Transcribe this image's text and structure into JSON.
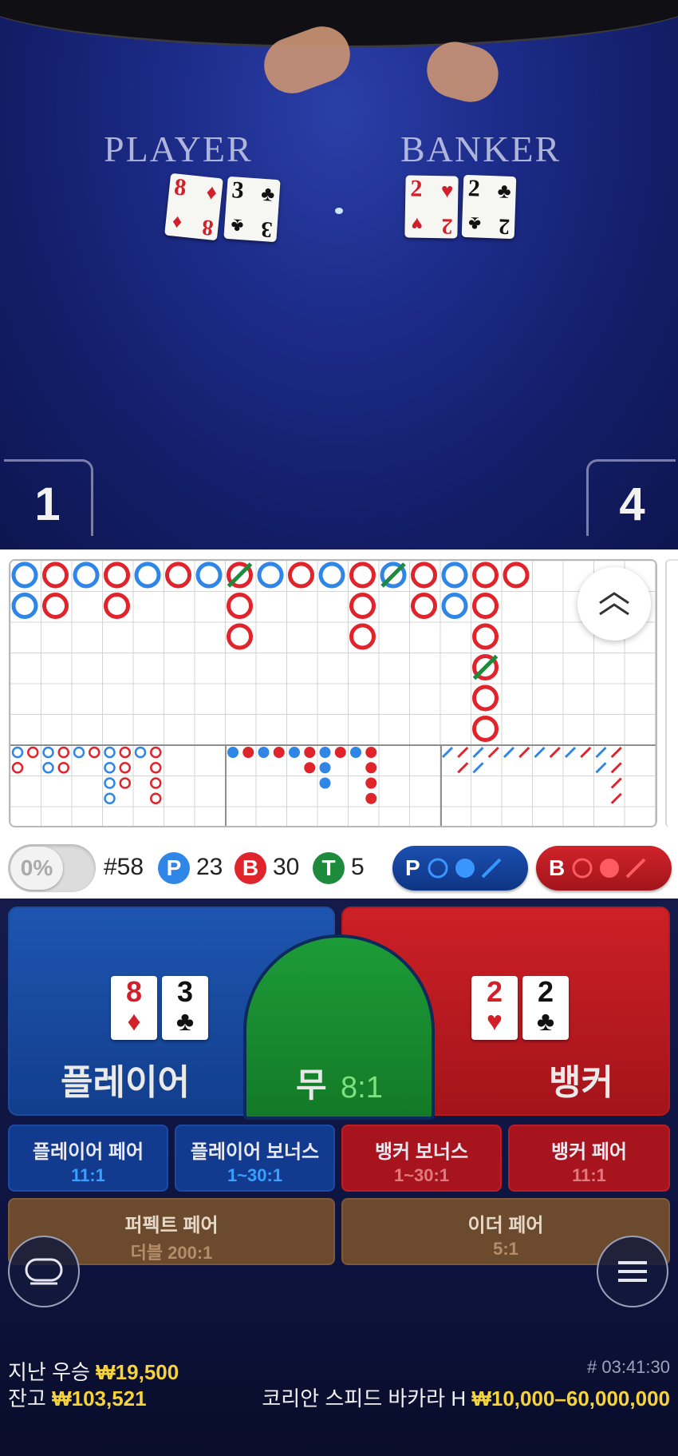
{
  "video": {
    "player_label": "PLAYER",
    "banker_label": "BANKER",
    "player_cards": [
      {
        "rank": "8",
        "suit": "♦",
        "color": "red"
      },
      {
        "rank": "3",
        "suit": "♣",
        "color": "black"
      }
    ],
    "banker_cards": [
      {
        "rank": "2",
        "suit": "♥",
        "color": "red"
      },
      {
        "rank": "2",
        "suit": "♣",
        "color": "black"
      }
    ],
    "player_score": "1",
    "banker_score": "4"
  },
  "stats": {
    "percent_toggle": "0%",
    "shoe_number": "#58",
    "player_letter": "P",
    "player_count": "23",
    "banker_letter": "B",
    "banker_count": "30",
    "tie_letter": "T",
    "tie_count": "5",
    "predict_player_label": "P",
    "predict_banker_label": "B"
  },
  "bets": {
    "player": {
      "label": "플레이어",
      "cards": [
        {
          "rank": "8",
          "suit": "♦",
          "color": "red"
        },
        {
          "rank": "3",
          "suit": "♣",
          "color": "black"
        }
      ]
    },
    "tie": {
      "label": "무",
      "odds": "8:1"
    },
    "banker": {
      "label": "뱅커",
      "cards": [
        {
          "rank": "2",
          "suit": "♥",
          "color": "red"
        },
        {
          "rank": "2",
          "suit": "♣",
          "color": "black"
        }
      ]
    },
    "player_pair": {
      "label": "플레이어 페어",
      "odds": "11:1"
    },
    "player_bonus": {
      "label": "플레이어 보너스",
      "odds": "1~30:1"
    },
    "banker_bonus": {
      "label": "뱅커 보너스",
      "odds": "1~30:1"
    },
    "banker_pair": {
      "label": "뱅커 페어",
      "odds": "11:1"
    },
    "perfect_pair": {
      "label": "퍼펙트 페어",
      "odds": "더블 200:1"
    },
    "either_pair": {
      "label": "이더 페어",
      "odds": "5:1"
    }
  },
  "footer": {
    "last_win_label": "지난 우승",
    "last_win_value": "₩19,500",
    "balance_label": "잔고",
    "balance_value": "₩103,521",
    "round_id": "# 03:41:30",
    "table_name": "코리안 스피드 바카라 H",
    "limits": "₩10,000–60,000,000"
  },
  "roadmap": {
    "big_road": [
      [
        "P",
        "P"
      ],
      [
        "B",
        "B"
      ],
      [
        "P"
      ],
      [
        "B",
        "B"
      ],
      [
        "P"
      ],
      [
        "B"
      ],
      [
        "P"
      ],
      [
        "B*",
        "B",
        "B"
      ],
      [
        "P"
      ],
      [
        "B"
      ],
      [
        "P"
      ],
      [
        "B",
        "B",
        "B"
      ],
      [
        "P2"
      ],
      [
        "B",
        "B"
      ],
      [
        "P",
        "P"
      ],
      [
        "B",
        "B",
        "B",
        "B*",
        "B",
        "B"
      ],
      [
        "B"
      ]
    ],
    "colors": {
      "player": "#2f86e6",
      "banker": "#e0242c",
      "tie": "#1e8a3c"
    }
  }
}
